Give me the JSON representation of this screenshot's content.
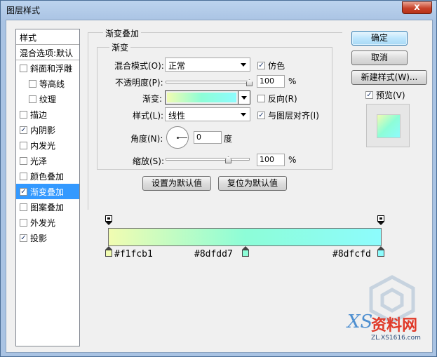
{
  "window": {
    "title": "图层样式",
    "close_glyph": "x"
  },
  "sidebar": {
    "header": "样式",
    "blend_options": "混合选项:默认",
    "items": [
      {
        "label": "斜面和浮雕",
        "checked": false,
        "indent": false
      },
      {
        "label": "等高线",
        "checked": false,
        "indent": true
      },
      {
        "label": "纹理",
        "checked": false,
        "indent": true
      },
      {
        "label": "描边",
        "checked": false,
        "indent": false
      },
      {
        "label": "内阴影",
        "checked": true,
        "indent": false
      },
      {
        "label": "内发光",
        "checked": false,
        "indent": false
      },
      {
        "label": "光泽",
        "checked": false,
        "indent": false
      },
      {
        "label": "颜色叠加",
        "checked": false,
        "indent": false
      },
      {
        "label": "渐变叠加",
        "checked": true,
        "indent": false,
        "selected": true
      },
      {
        "label": "图案叠加",
        "checked": false,
        "indent": false
      },
      {
        "label": "外发光",
        "checked": false,
        "indent": false
      },
      {
        "label": "投影",
        "checked": true,
        "indent": false
      }
    ]
  },
  "panel": {
    "group_title": "渐变叠加",
    "subgroup_title": "渐变",
    "blend_mode_label": "混合模式(O):",
    "blend_mode_value": "正常",
    "dither_label": "仿色",
    "dither_checked": true,
    "opacity_label": "不透明度(P):",
    "opacity_value": "100",
    "opacity_unit": "%",
    "opacity_level": 1.0,
    "gradient_label": "渐变:",
    "reverse_label": "反向(R)",
    "reverse_checked": false,
    "style_label": "样式(L):",
    "style_value": "线性",
    "align_label": "与图层对齐(I)",
    "align_checked": true,
    "angle_label": "角度(N):",
    "angle_value": "0",
    "angle_unit": "度",
    "scale_label": "缩放(S):",
    "scale_value": "100",
    "scale_unit": "%",
    "scale_level": 0.75,
    "set_default_label": "设置为默认值",
    "reset_default_label": "复位为默认值"
  },
  "buttons": {
    "ok": "确定",
    "cancel": "取消",
    "new_style": "新建样式(W)...",
    "preview_label": "预览(V)",
    "preview_checked": true
  },
  "gradient": {
    "stops": [
      {
        "color": "#f1fcb1",
        "label": "#f1fcb1"
      },
      {
        "color": "#8dfdd7",
        "label": "#8dfdd7"
      },
      {
        "color": "#8dfcfd",
        "label": "#8dfcfd"
      }
    ],
    "opacity_stop_color": "#111111"
  },
  "colors": {
    "selection": "#3399ff",
    "window_frame": "#a9c3e3"
  },
  "watermark": {
    "text": "资料网",
    "letters": "XS",
    "url": "ZL.XS1616.com"
  }
}
